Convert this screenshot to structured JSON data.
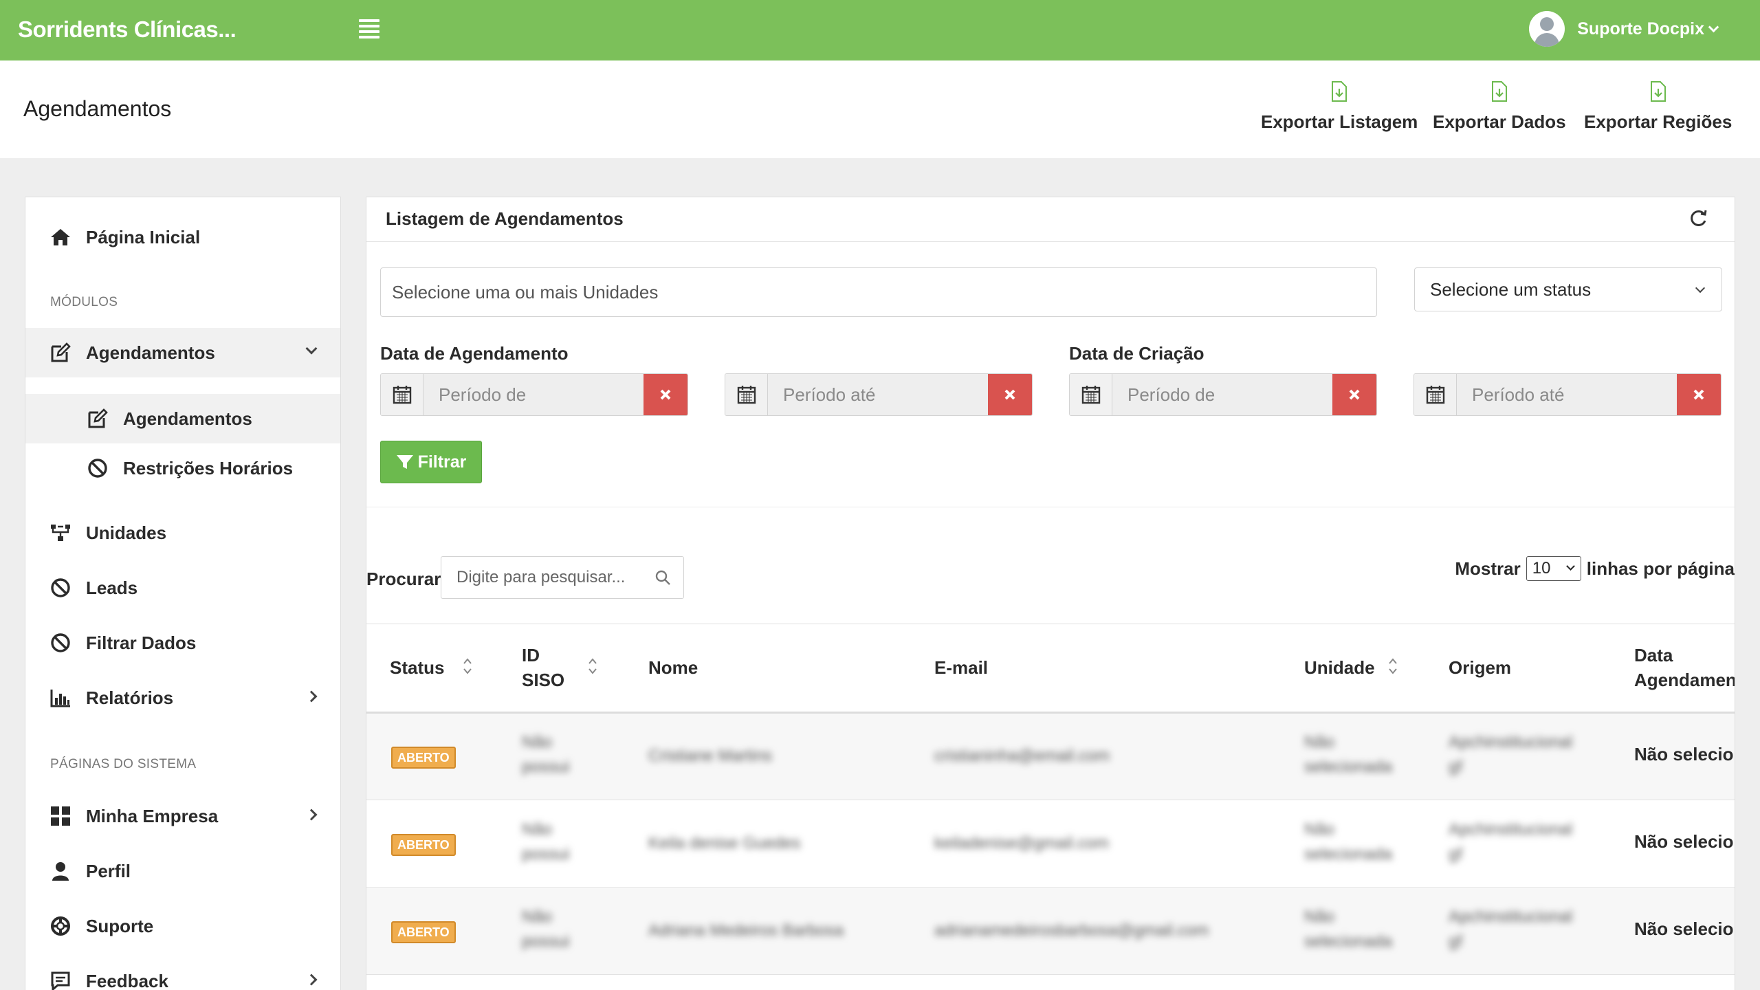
{
  "topbar": {
    "brand": "Sorridents Clínicas...",
    "user_name": "Suporte Docpix",
    "primary_color": "#7cc05a"
  },
  "header": {
    "title": "Agendamentos",
    "exports": [
      {
        "label": "Exportar Listagem",
        "icon": "file-download-icon"
      },
      {
        "label": "Exportar Dados",
        "icon": "file-download-icon"
      },
      {
        "label": "Exportar Regiões",
        "icon": "file-download-icon"
      }
    ]
  },
  "sidebar": {
    "home": "Página Inicial",
    "section_modules": "MÓDULOS",
    "agendamentos": "Agendamentos",
    "sub_agendamentos": "Agendamentos",
    "sub_restricoes": "Restrições Horários",
    "unidades": "Unidades",
    "leads": "Leads",
    "filtrar_dados": "Filtrar Dados",
    "relatorios": "Relatórios",
    "section_system": "PÁGINAS DO SISTEMA",
    "minha_empresa": "Minha Empresa",
    "perfil": "Perfil",
    "suporte": "Suporte",
    "feedback": "Feedback"
  },
  "panel": {
    "title": "Listagem de Agendamentos",
    "units_placeholder": "Selecione uma ou mais Unidades",
    "status_placeholder": "Selecione um status",
    "label_agendamento": "Data de Agendamento",
    "label_criacao": "Data de Criação",
    "date_from": "Período de",
    "date_to": "Período até",
    "filter_button": "Filtrar",
    "search_label": "Procurar",
    "search_placeholder": "Digite para pesquisar...",
    "show_label": "Mostrar",
    "rows_per_page": "10",
    "rows_suffix": "linhas por página",
    "danger_color": "#d9534f"
  },
  "table": {
    "headers": {
      "status": "Status",
      "id_siso_1": "ID",
      "id_siso_2": "SISO",
      "nome": "Nome",
      "email": "E-mail",
      "unidade": "Unidade",
      "origem": "Origem",
      "data_1": "Data",
      "data_2": "Agendament"
    },
    "rows": [
      {
        "status": "ABERTO",
        "id_1": "Não",
        "id_2": "possui",
        "nome": "Cristiane Martins",
        "email": "cristianinha@email.com",
        "unidade_1": "Não",
        "unidade_2": "selecionada",
        "origem_1": "Apchinstitucional",
        "origem_2": "gf",
        "data": "Não selecior"
      },
      {
        "status": "ABERTO",
        "id_1": "Não",
        "id_2": "possui",
        "nome": "Keila denise Guedes",
        "email": "keiladenise@gmail.com",
        "unidade_1": "Não",
        "unidade_2": "selecionada",
        "origem_1": "Apchinstitucional",
        "origem_2": "gf",
        "data": "Não selecior"
      },
      {
        "status": "ABERTO",
        "id_1": "Não",
        "id_2": "possui",
        "nome": "Adriana Medeiros Barbosa",
        "email": "adrianamedeirosbarbosa@gmail.com",
        "unidade_1": "Não",
        "unidade_2": "selecionada",
        "origem_1": "Apchinstitucional",
        "origem_2": "gf",
        "data": "Não selecior"
      }
    ]
  }
}
